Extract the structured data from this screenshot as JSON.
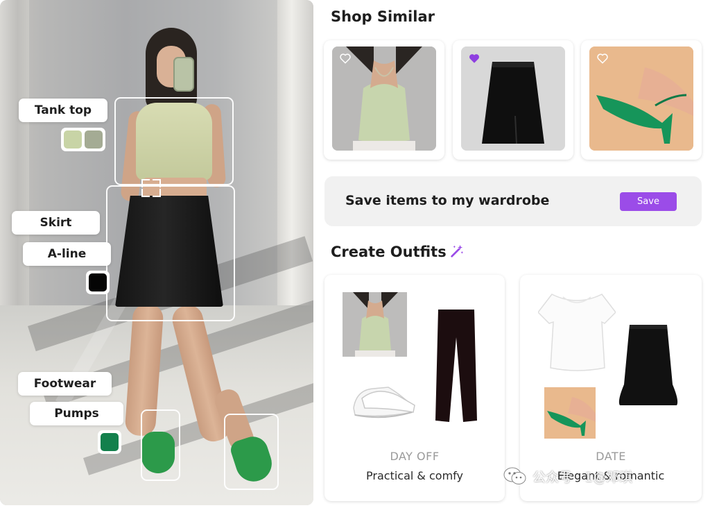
{
  "photo_tags": {
    "tank_top": "Tank top",
    "skirt": "Skirt",
    "a_line": "A-line",
    "footwear": "Footwear",
    "pumps": "Pumps"
  },
  "swatch_colors": {
    "tank_top": [
      "#c8d4a6",
      "#a4ab94"
    ],
    "skirt": [
      "#050505"
    ],
    "footwear": [
      "#13804c"
    ]
  },
  "shop_similar": {
    "title": "Shop Similar",
    "items": [
      {
        "name": "tank-top",
        "favorited": false,
        "heart_icon": "heart-outline-icon"
      },
      {
        "name": "black-skirt",
        "favorited": true,
        "heart_icon": "heart-filled-icon"
      },
      {
        "name": "green-heels",
        "favorited": false,
        "heart_icon": "heart-outline-icon"
      }
    ]
  },
  "wardrobe": {
    "text": "Save items to my wardrobe",
    "save_label": "Save"
  },
  "create_outfits": {
    "title": "Create Outfits",
    "icon": "magic-wand-icon",
    "outfits": [
      {
        "category": "DAY OFF",
        "description": "Practical & comfy"
      },
      {
        "category": "DATE",
        "description": "Elegant & romantic"
      }
    ]
  },
  "watermark": {
    "icon": "wechat-icon",
    "text": "公众号 · 1@邓琪"
  },
  "colors": {
    "accent": "#9b4ce8",
    "heart_filled": "#8e3fe0",
    "card_bg": "#ffffff",
    "save_bar_bg": "#f1f1f1"
  }
}
